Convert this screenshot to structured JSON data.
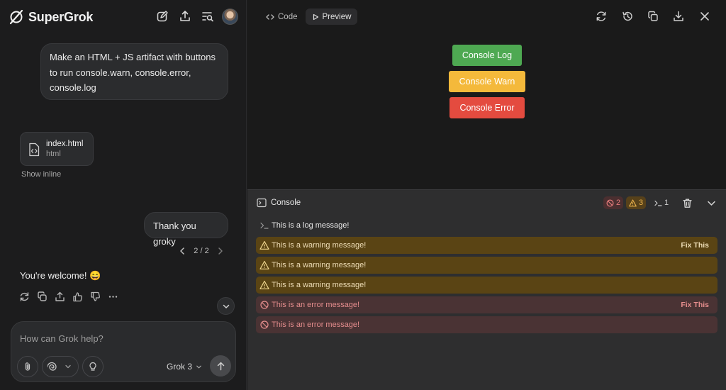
{
  "app": {
    "name": "SuperGrok"
  },
  "chat": {
    "messages": [
      {
        "role": "user",
        "text": "Make an HTML + JS artifact with buttons to run console.warn, console.error, console.log"
      },
      {
        "role": "user",
        "text": "Thank you groky"
      }
    ],
    "attachment": {
      "name": "index.html",
      "type": "html",
      "show_inline": "Show inline"
    },
    "pager": "2 / 2",
    "reply": "You're welcome! 😄",
    "composer": {
      "placeholder": "How can Grok help?",
      "model": "Grok 3"
    }
  },
  "artifact": {
    "tabs": [
      {
        "label": "Code",
        "active": false
      },
      {
        "label": "Preview",
        "active": true
      }
    ],
    "preview_buttons": [
      {
        "label": "Console Log",
        "color": "#4ea952"
      },
      {
        "label": "Console Warn",
        "color": "#f4b93b"
      },
      {
        "label": "Console Error",
        "color": "#e44b3f"
      }
    ],
    "console": {
      "title": "Console",
      "counts": {
        "errors": "2",
        "warnings": "3",
        "logs": "1"
      },
      "entries": [
        {
          "level": "log",
          "text": "This is a log message!",
          "action": ""
        },
        {
          "level": "warn",
          "text": "This is a warning message!",
          "action": "Fix This"
        },
        {
          "level": "warn",
          "text": "This is a warning message!",
          "action": ""
        },
        {
          "level": "warn",
          "text": "This is a warning message!",
          "action": ""
        },
        {
          "level": "error",
          "text": "This is an error message!",
          "action": "Fix This"
        },
        {
          "level": "error",
          "text": "This is an error message!",
          "action": ""
        }
      ]
    }
  }
}
